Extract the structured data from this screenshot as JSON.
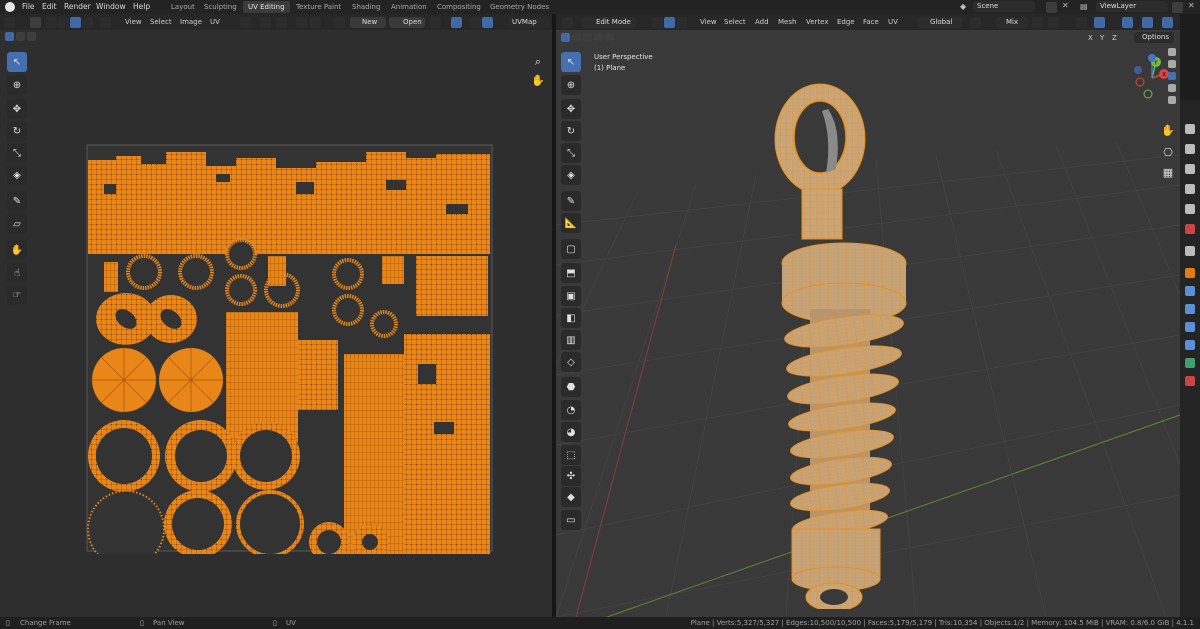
{
  "menu": {
    "file": "File",
    "edit": "Edit",
    "render": "Render",
    "window": "Window",
    "help": "Help"
  },
  "workspaces": [
    "Layout",
    "Sculpting",
    "UV Editing",
    "Texture Paint",
    "Shading",
    "Animation",
    "Compositing",
    "Geometry Nodes"
  ],
  "active_workspace": "UV Editing",
  "scene": {
    "name": "Scene",
    "view_layer": "ViewLayer"
  },
  "uv_editor": {
    "header": {
      "view": "View",
      "select": "Select",
      "image": "Image",
      "uv": "UV",
      "new": "New",
      "open": "Open",
      "uvmap": "UVMap"
    }
  },
  "viewport": {
    "header": {
      "mode": "Edit Mode",
      "view": "View",
      "select": "Select",
      "add": "Add",
      "mesh": "Mesh",
      "vertex": "Vertex",
      "edge": "Edge",
      "face": "Face",
      "uv": "UV",
      "orientation": "Global",
      "pivot": "Mix",
      "options": "Options",
      "x": "X",
      "y": "Y",
      "z": "Z"
    },
    "overlay_text": {
      "perspective": "User Perspective",
      "object": "(1) Plane"
    },
    "gizmo": {
      "x": "X",
      "y": "Y",
      "z": "Z"
    }
  },
  "status": {
    "left": "Change Frame",
    "middle": "Pan View",
    "right": "UV",
    "stats": "Plane | Verts:5,327/5,327 | Edges:10,500/10,500 | Faces:5,179/5,179 | Tris:10,354 | Objects:1/2 | Memory: 104.5 MiB | VRAM: 0.8/6.0 GiB | 4.1.1"
  },
  "colors": {
    "accent": "#4570b0",
    "mesh": "#e07c10",
    "mesh_fill": "#c9a57a",
    "wire": "#e8901c"
  },
  "icons": [
    "blender-logo",
    "cursor-icon",
    "move-icon",
    "rotate-icon",
    "scale-icon",
    "transform-icon",
    "annotate-icon",
    "measure-icon",
    "zoom-icon",
    "hand-icon",
    "camera-icon",
    "grid-icon"
  ]
}
